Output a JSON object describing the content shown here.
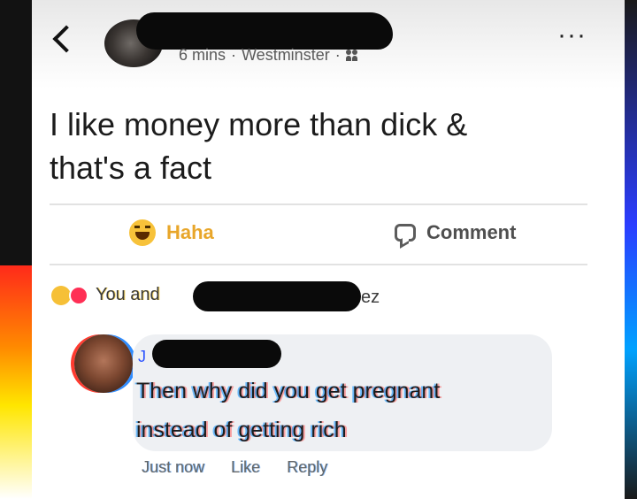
{
  "post": {
    "meta_time": "6 mins",
    "meta_location": "Westminster",
    "text_line1": "I like money more than dick &",
    "text_line2": "that's a fact"
  },
  "actions": {
    "haha_label": "Haha",
    "comment_label": "Comment"
  },
  "reactions": {
    "prefix": "You and",
    "suffix": "ez"
  },
  "comment": {
    "author_initial": "J",
    "line1": "Then why did you get pregnant",
    "line2": "instead of getting rich",
    "time": "Just now",
    "like_label": "Like",
    "reply_label": "Reply"
  },
  "colors": {
    "haha": "#e8a62a",
    "love": "#ff2f55"
  },
  "icons": [
    "back-icon",
    "more-icon",
    "friends-icon",
    "haha-icon",
    "comment-icon"
  ]
}
